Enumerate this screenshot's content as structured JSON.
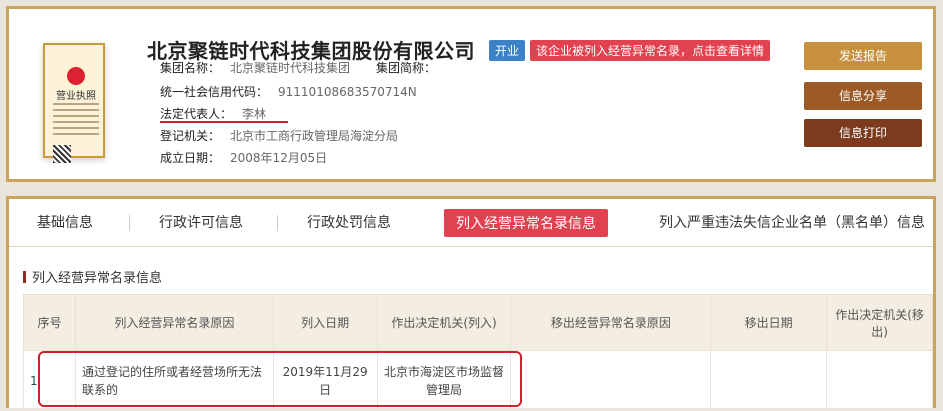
{
  "company": {
    "name": "北京聚链时代科技集团股份有限公司",
    "status": "开业",
    "warning": "该企业被列入经营异常名录，点击查看详情",
    "license_title": "营业执照"
  },
  "info": {
    "group_name_label": "集团名称：",
    "group_name_value": "北京聚链时代科技集团",
    "group_short_label": "集团简称：",
    "credit_code_label": "统一社会信用代码：",
    "credit_code_value": "91110108683570714N",
    "legal_rep_label": "法定代表人：",
    "legal_rep_value": "李林",
    "authority_label": "登记机关：",
    "authority_value": "北京市工商行政管理局海淀分局",
    "founded_label": "成立日期：",
    "founded_value": "2008年12月05日"
  },
  "actions": {
    "send_report": "发送报告",
    "share": "信息分享",
    "print": "信息打印"
  },
  "tabs": [
    "基础信息",
    "行政许可信息",
    "行政处罚信息",
    "列入经营异常名录信息",
    "列入严重违法失信企业名单（黑名单）信息"
  ],
  "active_tab": "列入经营异常名录信息",
  "section_title": "列入经营异常名录信息",
  "table": {
    "headers": [
      "序号",
      "列入经营异常名录原因",
      "列入日期",
      "作出决定机关(列入)",
      "移出经营异常名录原因",
      "移出日期",
      "作出决定机关(移出)"
    ],
    "rows": [
      [
        "1",
        "通过登记的住所或者经营场所无法联系的",
        "2019年11月29日",
        "北京市海淀区市场监督管理局",
        "",
        "",
        ""
      ]
    ]
  },
  "colors": {
    "gold_border": "#c9a45a",
    "badge_blue": "#3b82c9",
    "alert_red": "#e0434f"
  }
}
